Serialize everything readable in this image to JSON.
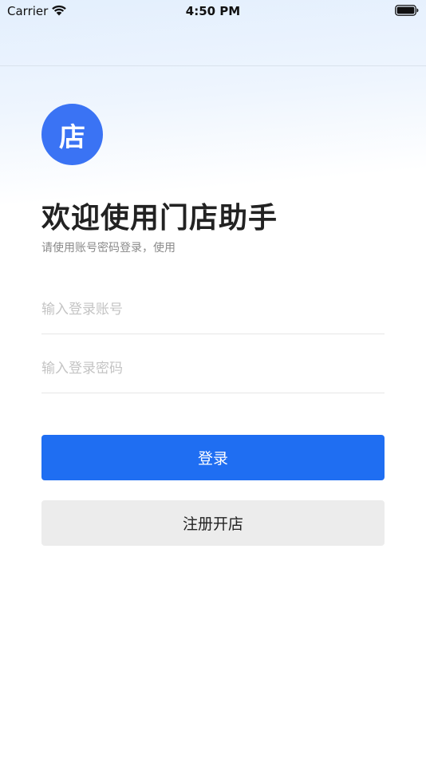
{
  "status_bar": {
    "carrier": "Carrier",
    "time": "4:50 PM",
    "wifi_icon": "wifi-icon",
    "battery_icon": "battery-icon"
  },
  "logo": {
    "text": "店",
    "color": "#3a73f4"
  },
  "header": {
    "title": "欢迎使用门店助手",
    "subtitle": "请使用账号密码登录，使用"
  },
  "form": {
    "account_placeholder": "输入登录账号",
    "account_value": "",
    "password_placeholder": "输入登录密码",
    "password_value": ""
  },
  "buttons": {
    "login_label": "登录",
    "login_color": "#1f6ef2",
    "register_label": "注册开店",
    "register_color": "#ececec"
  }
}
